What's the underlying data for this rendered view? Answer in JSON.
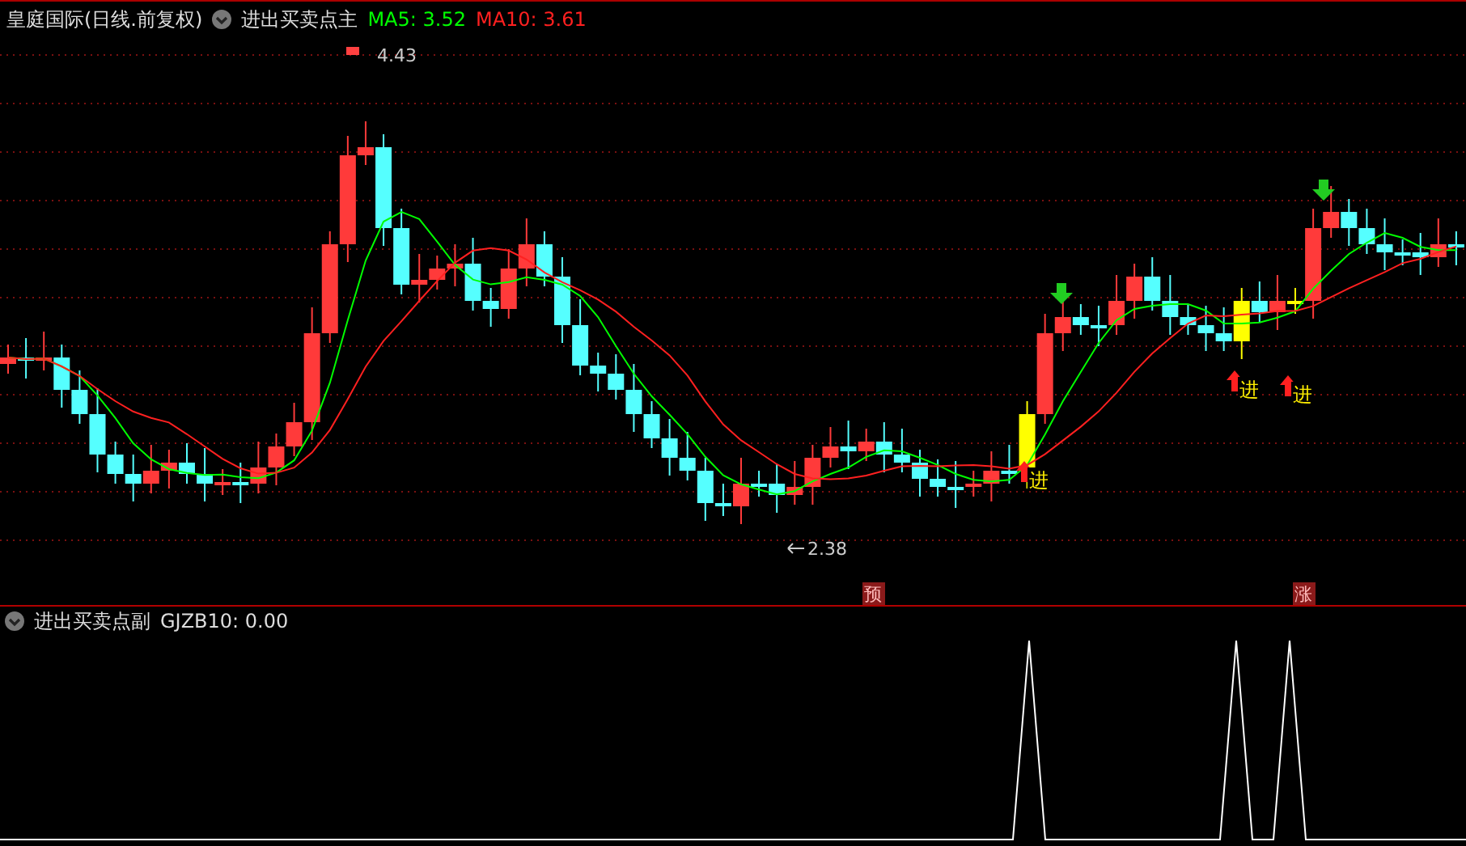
{
  "header": {
    "title": "皇庭国际(日线.前复权)",
    "indicator": "进出买卖点主",
    "ma": [
      {
        "label": "MA5: 3.52",
        "color": "#00ff00"
      },
      {
        "label": "MA10: 3.61",
        "color": "#ff2020"
      }
    ]
  },
  "main_chart": {
    "high_label": "4.43",
    "low_label": "2.38",
    "signals": [
      {
        "text": "进"
      },
      {
        "text": "进"
      },
      {
        "text": "进"
      }
    ],
    "badges": [
      {
        "text": "预"
      },
      {
        "text": "涨"
      }
    ]
  },
  "sub_panel": {
    "indicator": "进出买卖点副",
    "reading": "GJZB10: 0.00"
  }
}
